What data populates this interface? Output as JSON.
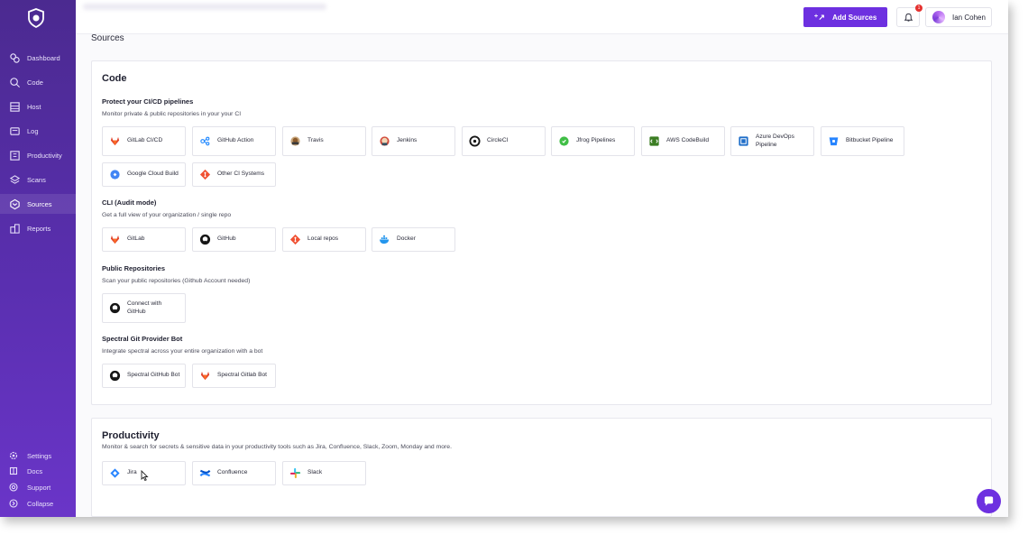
{
  "sidebar": {
    "items": [
      {
        "label": "Dashboard",
        "icon": "dashboard-icon"
      },
      {
        "label": "Code",
        "icon": "code-icon"
      },
      {
        "label": "Host",
        "icon": "host-icon"
      },
      {
        "label": "Log",
        "icon": "log-icon"
      },
      {
        "label": "Productivity",
        "icon": "productivity-icon"
      },
      {
        "label": "Scans",
        "icon": "scans-icon"
      },
      {
        "label": "Sources",
        "icon": "sources-icon"
      },
      {
        "label": "Reports",
        "icon": "reports-icon"
      }
    ],
    "active": "Sources",
    "bottom": [
      {
        "label": "Settings",
        "icon": "gear-icon"
      },
      {
        "label": "Docs",
        "icon": "book-icon"
      },
      {
        "label": "Support",
        "icon": "help-icon"
      },
      {
        "label": "Collapse",
        "icon": "collapse-icon"
      }
    ]
  },
  "topbar": {
    "add_sources_label": "Add Sources",
    "notification_count": "1",
    "user_name": "Ian Cohen"
  },
  "page": {
    "title": "Sources"
  },
  "code_card": {
    "title": "Code",
    "ci": {
      "title": "Protect your CI/CD pipelines",
      "desc": "Monitor private & public repositories in your your CI",
      "tiles": [
        "GitLab CI/CD",
        "GitHub Action",
        "Travis",
        "Jenkins",
        "CircleCI",
        "Jfrog Pipelines",
        "AWS CodeBuild",
        "Azure DevOps Pipeline",
        "Bitbucket Pipeline",
        "Google Cloud Build",
        "Other CI Systems"
      ]
    },
    "cli": {
      "title": "CLI (Audit mode)",
      "desc": "Get a full view of your organization / single repo",
      "tiles": [
        "GitLab",
        "GitHub",
        "Local repos",
        "Docker"
      ]
    },
    "public": {
      "title": "Public Repositories",
      "desc": "Scan your public repositories (Github Account needed)",
      "tiles": [
        "Connect with GitHub"
      ]
    },
    "bot": {
      "title": "Spectral Git Provider Bot",
      "desc": "Integrate spectral across your entire organization with a bot",
      "tiles": [
        "Spectral GitHub Bot",
        "Spectral Gitlab Bot"
      ]
    }
  },
  "productivity_card": {
    "title": "Productivity",
    "desc": "Monitor & search for secrets & sensitive data in your productivity tools such as Jira, Confluence, Slack, Zoom, Monday and more.",
    "tiles": [
      "Jira",
      "Confluence",
      "Slack"
    ]
  },
  "colors": {
    "brand": "#6d30e0",
    "sidebar": "#5a2fb0",
    "badge": "#e5312f"
  }
}
